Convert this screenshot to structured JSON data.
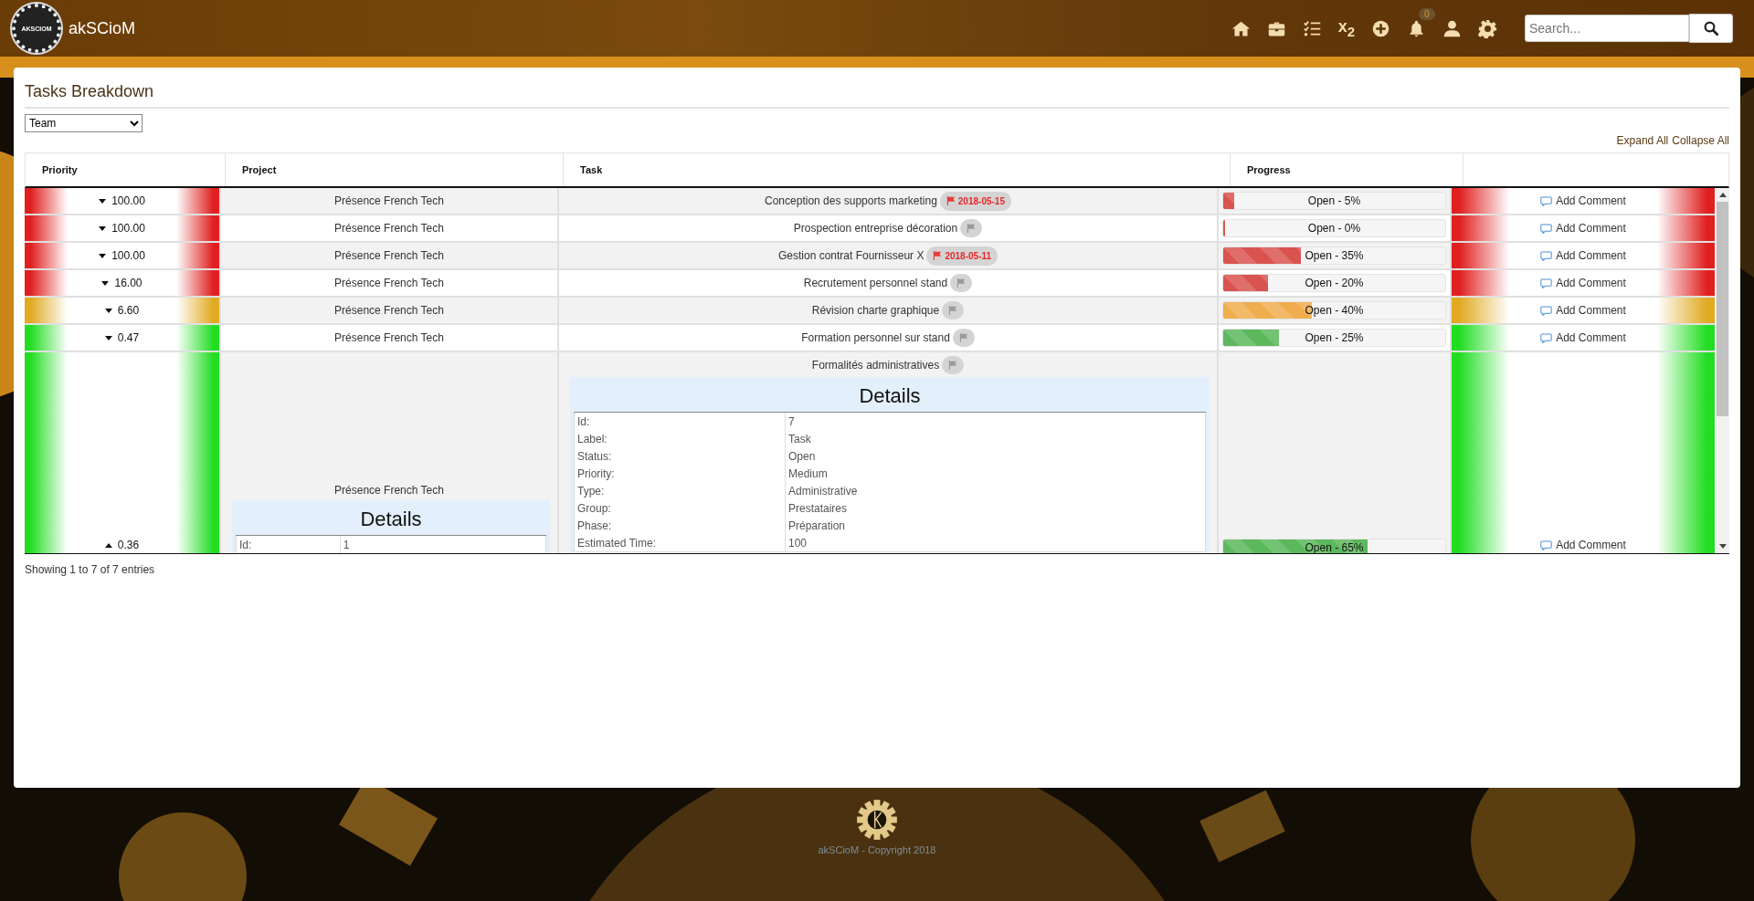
{
  "header": {
    "logo_text": "AKSCIOM",
    "brand": "akSCioM",
    "nav_glyph": "x$_{2}$",
    "notification_count": "0",
    "search": {
      "placeholder": "Search..."
    }
  },
  "page": {
    "title": "Tasks Breakdown",
    "group_select": "Team",
    "expand_all": "Expand All",
    "collapse_all": "Collapse All"
  },
  "table": {
    "columns": [
      "Priority",
      "Project",
      "Task",
      "Progress"
    ],
    "rows": [
      {
        "priority": "100.00",
        "color": "#e02020",
        "expanded": false,
        "project": "Présence French Tech",
        "task": "Conception des supports marketing",
        "due": "2018-05-15",
        "progress": {
          "label": "Open - 5%",
          "level": 0.05,
          "color": "#d9534f"
        },
        "comment": "Add Comment"
      },
      {
        "priority": "100.00",
        "color": "#e02020",
        "expanded": false,
        "project": "Présence French Tech",
        "task": "Prospection entreprise décoration",
        "progress": {
          "label": "Open - 0%",
          "level": 0,
          "color": "#d9534f"
        },
        "comment": "Add Comment"
      },
      {
        "priority": "100.00",
        "color": "#e02020",
        "expanded": false,
        "project": "Présence French Tech",
        "task": "Gestion contrat Fournisseur X",
        "due": "2018-05-11",
        "progress": {
          "label": "Open - 35%",
          "level": 0.35,
          "color": "#d9534f"
        },
        "comment": "Add Comment"
      },
      {
        "priority": "16.00",
        "color": "#e02020",
        "expanded": false,
        "project": "Présence French Tech",
        "task": "Recrutement personnel stand",
        "progress": {
          "label": "Open - 20%",
          "level": 0.2,
          "color": "#d9534f"
        },
        "comment": "Add Comment"
      },
      {
        "priority": "6.60",
        "color": "#e0aa22",
        "expanded": false,
        "project": "Présence French Tech",
        "task": "Révision charte graphique",
        "progress": {
          "label": "Open - 40%",
          "level": 0.4,
          "color": "#f0ad4e"
        },
        "comment": "Add Comment"
      },
      {
        "priority": "0.47",
        "color": "#22dd22",
        "expanded": false,
        "project": "Présence French Tech",
        "task": "Formation personnel sur stand",
        "progress": {
          "label": "Open - 25%",
          "level": 0.25,
          "color": "#5cb85c"
        },
        "comment": "Add Comment"
      },
      {
        "priority": "0.36",
        "color": "#22dd22",
        "expanded": true,
        "project": "Présence French Tech",
        "task": "Formalités administratives",
        "progress": {
          "label": "Open - 65%",
          "level": 0.65,
          "color": "#5cb85c"
        },
        "comment": "Add Comment",
        "project_details": {
          "title": "Details",
          "fields": [
            {
              "key": "Id:",
              "value": "1"
            }
          ]
        },
        "task_details": {
          "title": "Details",
          "fields": [
            {
              "key": "Id:",
              "value": "7"
            },
            {
              "key": "Label:",
              "value": "Task"
            },
            {
              "key": "Status:",
              "value": "Open"
            },
            {
              "key": "Priority:",
              "value": "Medium"
            },
            {
              "key": "Type:",
              "value": "Administrative"
            },
            {
              "key": "Group:",
              "value": "Prestataires"
            },
            {
              "key": "Phase:",
              "value": "Préparation"
            },
            {
              "key": "Estimated Time:",
              "value": "100"
            }
          ]
        }
      }
    ],
    "info": "Showing 1 to 7 of 7 entries"
  },
  "footer": {
    "copyright": "akSCioM - Copyright 2018"
  }
}
